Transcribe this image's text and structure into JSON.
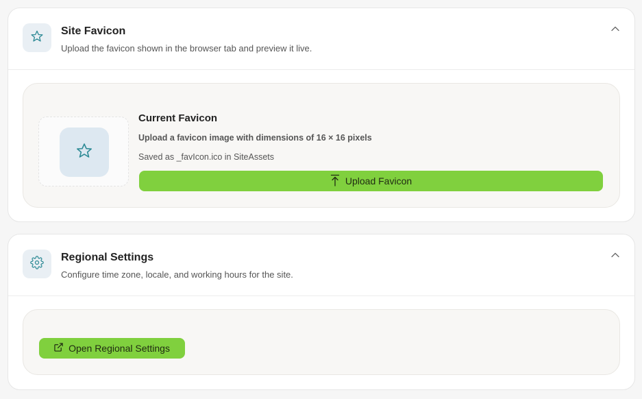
{
  "favicon_section": {
    "title": "Site Favicon",
    "subtitle": "Upload the favicon shown in the browser tab and preview it live.",
    "icon": "star-icon",
    "collapse_icon": "chevron-up-icon",
    "current": {
      "title": "Current Favicon",
      "description": "Upload a favicon image with dimensions of 16 × 16 pixels",
      "saved_as": "Saved as _favIcon.ico in SiteAssets",
      "preview_icon": "star-icon"
    },
    "upload_button": {
      "label": "Upload Favicon",
      "icon": "upload-icon"
    }
  },
  "regional_section": {
    "title": "Regional Settings",
    "subtitle": "Configure time zone, locale, and working hours for the site.",
    "icon": "gear-icon",
    "collapse_icon": "chevron-up-icon",
    "open_button": {
      "label": "Open Regional Settings",
      "icon": "external-link-icon"
    }
  },
  "colors": {
    "accent_green": "#80d03e",
    "icon_teal": "#2f8b96",
    "icon_bg": "#e9eff4"
  }
}
